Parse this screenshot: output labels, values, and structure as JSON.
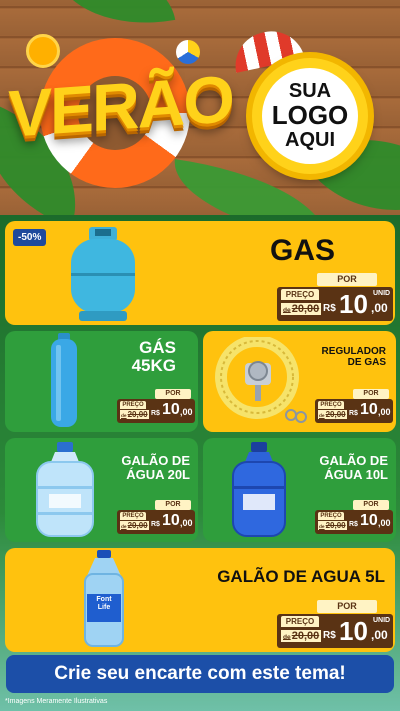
{
  "header": {
    "title": "VERÃO",
    "logo_line1": "SUA",
    "logo_line2": "LOGO",
    "logo_line3": "AQUI"
  },
  "products": [
    {
      "title": "GAS",
      "badge": "-50%",
      "preco": "PREÇO",
      "de": "de",
      "old_price": "20,00",
      "por": "POR",
      "currency": "R$",
      "price_int": "10",
      "price_dec": ",00",
      "unit": "UNID"
    },
    {
      "title_line1": "GÁS",
      "title_line2": "45KG",
      "preco": "PREÇO",
      "de": "de",
      "old_price": "20,00",
      "por": "POR",
      "currency": "R$",
      "price_int": "10",
      "price_dec": ",00"
    },
    {
      "title_line1": "REGULADOR",
      "title_line2": "DE GAS",
      "preco": "PREÇO",
      "de": "de",
      "old_price": "20,00",
      "por": "POR",
      "currency": "R$",
      "price_int": "10",
      "price_dec": ",00"
    },
    {
      "title_line1": "GALÃO DE",
      "title_line2": "ÁGUA 20L",
      "preco": "PREÇO",
      "de": "de",
      "old_price": "20,00",
      "por": "POR",
      "currency": "R$",
      "price_int": "10",
      "price_dec": ",00"
    },
    {
      "title_line1": "GALÃO DE",
      "title_line2": "ÁGUA 10L",
      "preco": "PREÇO",
      "de": "de",
      "old_price": "20,00",
      "por": "POR",
      "currency": "R$",
      "price_int": "10",
      "price_dec": ",00"
    },
    {
      "title": "GALÃO DE AGUA 5L",
      "bottle_brand_line1": "Font",
      "bottle_brand_line2": "Life",
      "preco": "PREÇO",
      "de": "de",
      "old_price": "20,00",
      "por": "POR",
      "currency": "R$",
      "price_int": "10",
      "price_dec": ",00",
      "unit": "UNID"
    }
  ],
  "banner": "Crie seu encarte com este tema!",
  "footnote": "*Imagens Meramente Ilustrativas",
  "colors": {
    "yellow_card": "#ffc20e",
    "green_card": "#2f9e3c",
    "banner_blue": "#1c4fa8",
    "tag_brown": "#5a3314"
  }
}
